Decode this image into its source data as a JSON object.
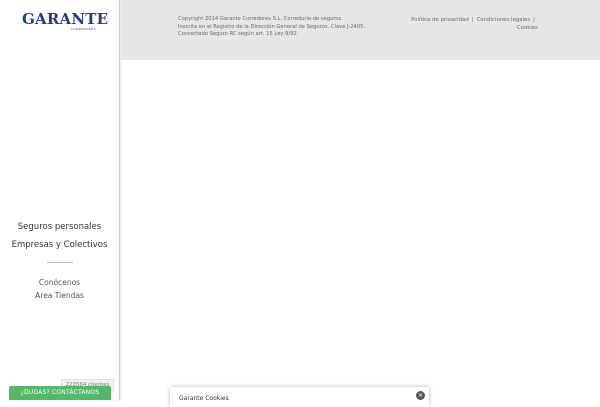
{
  "logo": {
    "text": "GARANTE",
    "subtext": "CORREDORES"
  },
  "nav": {
    "main": [
      "Seguros personales",
      "Empresas y Colectivos"
    ],
    "secondary": [
      "Conócenos",
      "Area Tiendas"
    ]
  },
  "footer": {
    "copyright_lines": [
      "Copyright 2014 Garante Corredores S.L. Correduría de seguros.",
      "Inscrita en el Registro de la Dirección General de Seguros. Clave J-2405.",
      "Concertado Seguro RC según art. 15 Ley 9/92"
    ],
    "links": [
      "Política de privacidad",
      "Condiciones legales",
      "Cookies"
    ],
    "separator": "|"
  },
  "widgets": {
    "clients_counter": "223564 clientes",
    "contact_button": "¿DUDAS? CONTÁCTANOS"
  },
  "cookie_panel": {
    "title": "Garante Cookies",
    "close_icon": "×"
  },
  "colors": {
    "brand": "#1f3f86",
    "footer_bg": "#e6e6e6",
    "contact_green": "#55b868"
  }
}
